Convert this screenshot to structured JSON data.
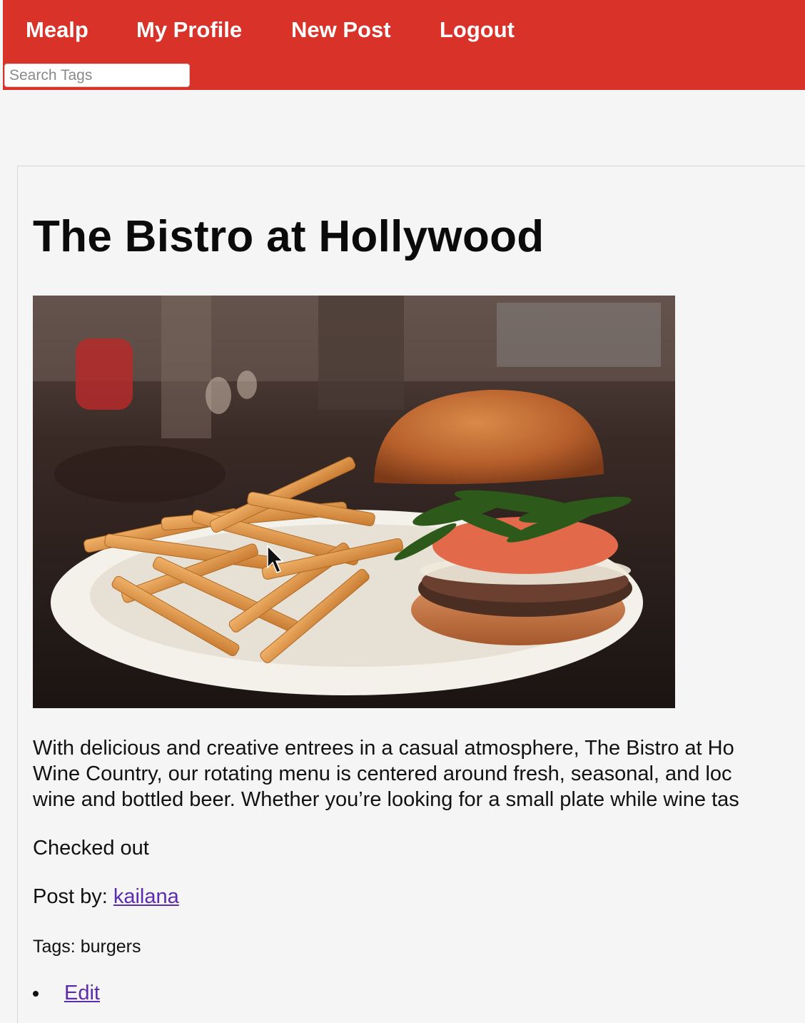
{
  "nav": {
    "brand": "Mealp",
    "profile": "My Profile",
    "new_post": "New Post",
    "logout": "Logout"
  },
  "search": {
    "placeholder": "Search Tags",
    "value": ""
  },
  "post": {
    "title": "The Bistro at Hollywood",
    "image_alt": "burger with fries on a plate",
    "description_lines": [
      "With delicious and creative entrees in a casual atmosphere, The Bistro at Ho",
      "Wine Country, our rotating menu is centered around fresh, seasonal, and loc",
      "wine and bottled beer. Whether you’re looking for a small plate while wine tas"
    ],
    "status": "Checked out",
    "author_label": "Post by: ",
    "author": "kailana",
    "tags_label": "Tags: ",
    "tags": "burgers",
    "actions": [
      "Edit"
    ]
  },
  "colors": {
    "nav_bg": "#d93229",
    "link": "#5b2bb0"
  }
}
